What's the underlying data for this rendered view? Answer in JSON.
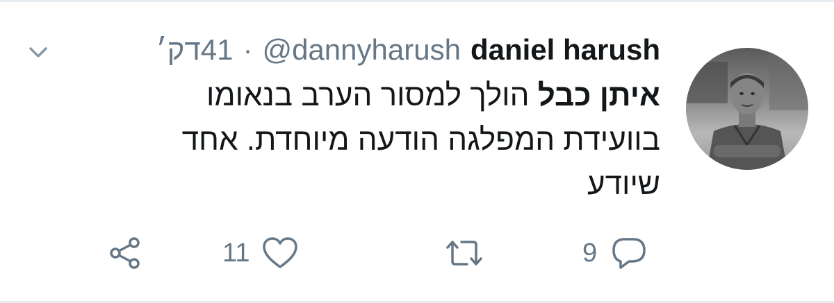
{
  "tweet": {
    "author": {
      "display_name": "daniel harush",
      "handle": "@dannyharush"
    },
    "separator": "·",
    "timestamp": "41דק׳",
    "text": {
      "mention": "איתן כבל",
      "body": " הולך למסור הערב בנאומו בוועידת המפלגה הודעה מיוחדת. אחד שיודע"
    },
    "actions": {
      "replies": {
        "icon": "reply-icon",
        "count": "9"
      },
      "retweets": {
        "icon": "retweet-icon",
        "count": ""
      },
      "likes": {
        "icon": "heart-icon",
        "count": "11"
      },
      "share": {
        "icon": "share-icon"
      }
    },
    "menu_icon": "chevron-down-icon"
  },
  "colors": {
    "text_primary": "#14171a",
    "text_secondary": "#657786",
    "border": "#e6ecf0"
  }
}
